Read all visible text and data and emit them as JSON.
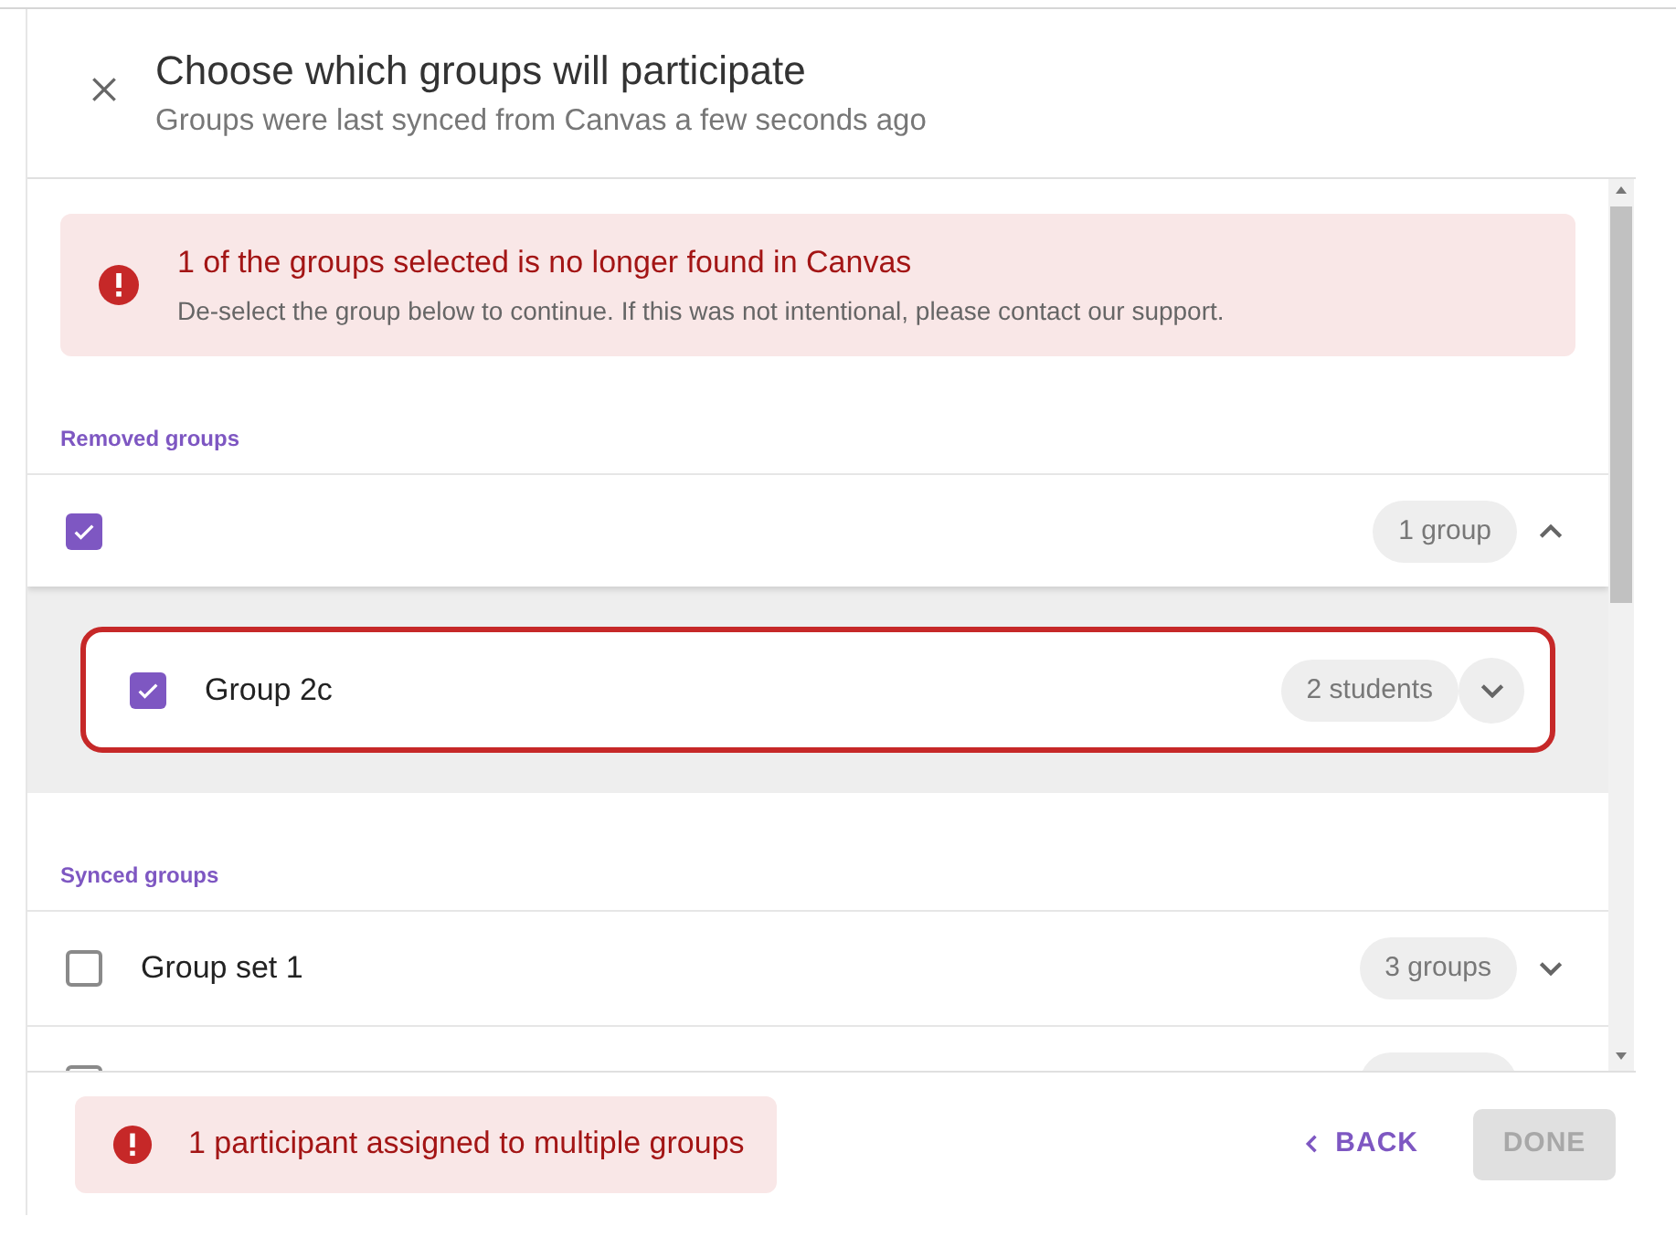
{
  "dialog": {
    "title": "Choose which groups will participate",
    "subtitle": "Groups were last synced from Canvas a few seconds ago"
  },
  "error_banner": {
    "title": "1 of the groups selected is no longer found in Canvas",
    "message": "De-select the group below to continue. If this was not intentional, please contact our support."
  },
  "removed": {
    "heading": "Removed groups",
    "set": {
      "checked": true,
      "count": "1 group",
      "expanded": true,
      "groups": [
        {
          "name": "Group 2c",
          "checked": true,
          "count": "2 students",
          "flagged": true,
          "expanded": false
        }
      ]
    }
  },
  "synced": {
    "heading": "Synced groups",
    "sets": [
      {
        "name": "Group set 1",
        "checked": false,
        "count": "3 groups",
        "expanded": false
      },
      {
        "checked": false
      }
    ]
  },
  "footer": {
    "warning": "1 participant assigned to multiple groups",
    "back": "BACK",
    "done": {
      "label": "DONE",
      "disabled": true
    }
  }
}
